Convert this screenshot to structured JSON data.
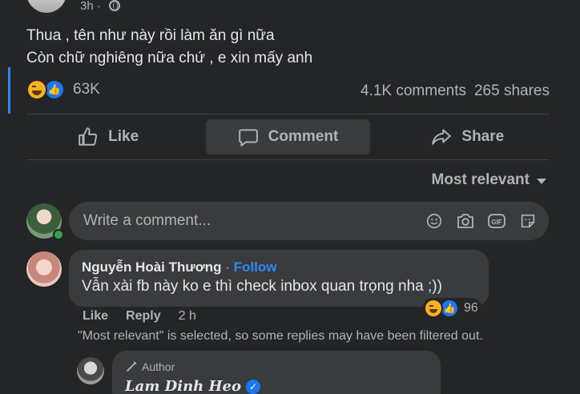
{
  "post": {
    "time": "3h",
    "text_line1": "Thua , tên như này rồi làm ăn gì nữa",
    "text_line2": "Còn chữ nghiêng nữa chứ , e xin mấy anh",
    "reaction_count": "63K",
    "comments_count": "4.1K comments",
    "shares_count": "265 shares"
  },
  "actions": {
    "like": "Like",
    "comment": "Comment",
    "share": "Share"
  },
  "sort_label": "Most relevant",
  "composer": {
    "placeholder": "Write a comment..."
  },
  "comment": {
    "author": "Nguyễn Hoài Thương",
    "separator": " · ",
    "follow": "Follow",
    "text": "Vẫn xài fb này ko e thì check inbox quan trọng nha ;))",
    "reaction_count": "96",
    "like_label": "Like",
    "reply_label": "Reply",
    "time": "2 h"
  },
  "filter_note": "\"Most relevant\" is selected, so some replies may have been filtered out.",
  "reply": {
    "badge": "Author",
    "author": "Lam Dinh Heo"
  },
  "colors": {
    "background": "#242526",
    "bubble": "#3a3b3c",
    "link": "#2d88ff",
    "like_blue": "#1877f2",
    "haha_yellow": "#f7b125"
  }
}
